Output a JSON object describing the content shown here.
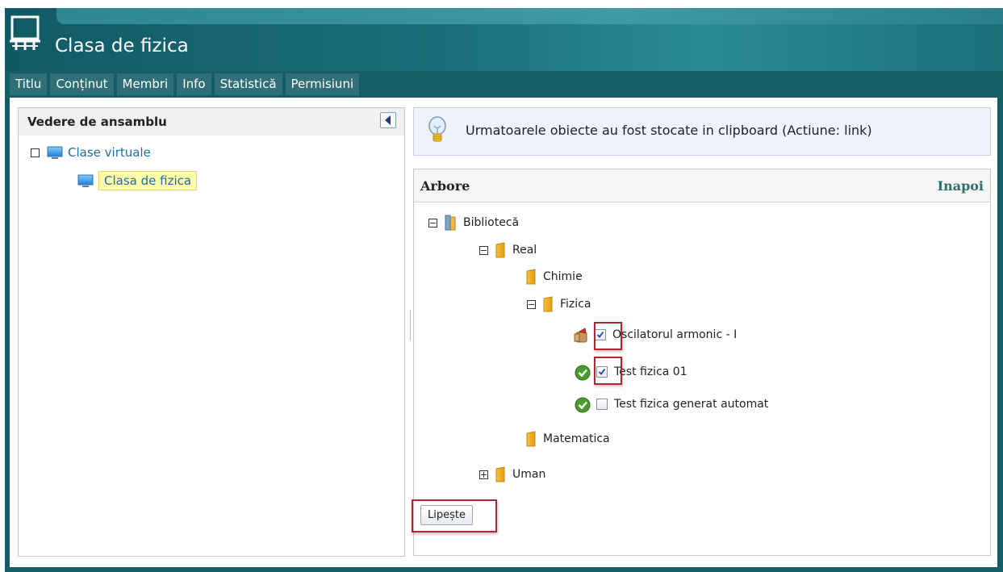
{
  "header": {
    "title": "Clasa de fizica"
  },
  "tabs": [
    {
      "label": "Titlu"
    },
    {
      "label": "Conținut"
    },
    {
      "label": "Membri"
    },
    {
      "label": "Info"
    },
    {
      "label": "Statistică"
    },
    {
      "label": "Permisiuni"
    }
  ],
  "sidebar": {
    "title": "Vedere de ansamblu",
    "tree": {
      "root": {
        "label": "Clase virtuale",
        "icon": "monitor-icon"
      },
      "child": {
        "label": "Clasa de fizica",
        "icon": "monitor-icon",
        "selected": true
      }
    }
  },
  "info": {
    "message": "Urmatoarele obiecte au fost stocate in clipboard (Actiune: link)",
    "icon": "lightbulb-icon"
  },
  "tree_panel": {
    "title": "Arbore",
    "back_label": "Inapoi",
    "nodes": {
      "biblioteca": {
        "label": "Bibliotecă",
        "icon": "library-icon",
        "state": "expanded"
      },
      "real": {
        "label": "Real",
        "icon": "folder-icon",
        "state": "expanded"
      },
      "chimie": {
        "label": "Chimie",
        "icon": "folder-icon"
      },
      "fizica": {
        "label": "Fizica",
        "icon": "folder-icon",
        "state": "expanded"
      },
      "oscilatorul": {
        "label": "Oscilatorul armonic - I",
        "icon": "lesson-icon",
        "checked": true
      },
      "test01": {
        "label": "Test fizica 01",
        "icon": "check-circle-icon",
        "checked": true
      },
      "test_auto": {
        "label": "Test fizica generat automat",
        "icon": "check-circle-icon",
        "checked": false
      },
      "matematica": {
        "label": "Matematica",
        "icon": "folder-icon"
      },
      "uman": {
        "label": "Uman",
        "icon": "folder-icon",
        "state": "collapsed"
      }
    },
    "paste_label": "Lipește"
  },
  "colors": {
    "header": "#155e68",
    "tab": "#2e6f78",
    "highlight": "#b3262e",
    "link": "#1c6ea6"
  }
}
